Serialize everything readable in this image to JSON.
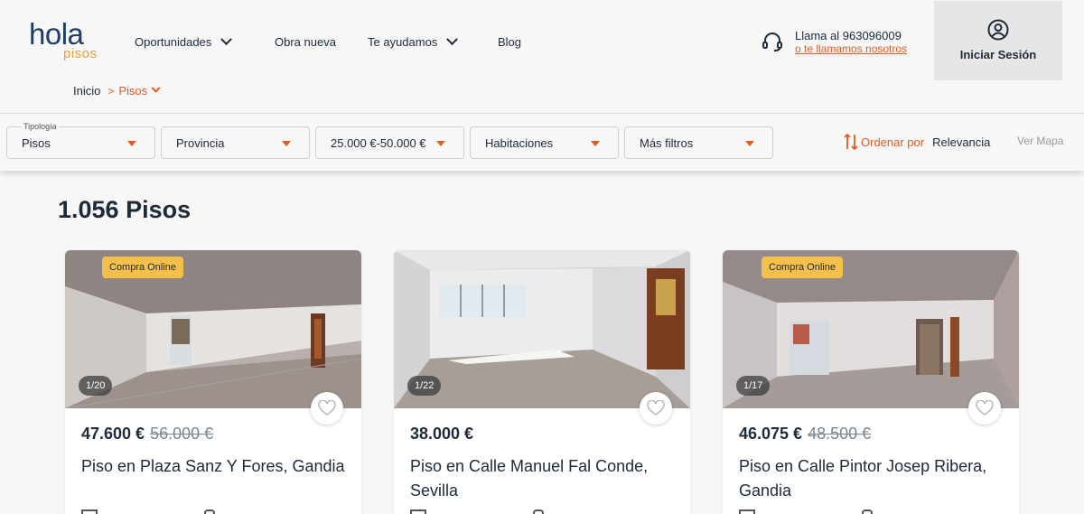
{
  "header": {
    "logo_main": "hola",
    "logo_sub": "pisos",
    "nav": [
      {
        "label": "Oportunidades",
        "dropdown": true
      },
      {
        "label": "Obra nueva",
        "dropdown": false
      },
      {
        "label": "Te ayudamos",
        "dropdown": true
      },
      {
        "label": "Blog",
        "dropdown": false
      }
    ],
    "phone_text": "Llama al 963096009",
    "callback_link": "o te llamamos nosotros",
    "login_label": "Iniciar Sesión"
  },
  "breadcrumb": {
    "home": "Inicio",
    "separator": ">",
    "current": "Pisos"
  },
  "filters": {
    "tipologia_label": "Tipología",
    "tipologia_value": "Pisos",
    "provincia": "Provincia",
    "precio": "25.000 €-50.000 €",
    "habitaciones": "Habitaciones",
    "mas_filtros": "Más filtros",
    "sort_label": "Ordenar por",
    "sort_value": "Relevancia",
    "ver_mapa": "Ver Mapa"
  },
  "results": {
    "title": "1.056 Pisos"
  },
  "listings": [
    {
      "badge": "Compra Online",
      "counter": "1/20",
      "price": "47.600 €",
      "old_price": "56.000 €",
      "title": "Piso en Plaza Sanz Y Fores, Gandia"
    },
    {
      "badge": "",
      "counter": "1/22",
      "price": "38.000 €",
      "old_price": "",
      "title": "Piso en Calle Manuel Fal Conde, Sevilla"
    },
    {
      "badge": "Compra Online",
      "counter": "1/17",
      "price": "46.075 €",
      "old_price": "48.500 €",
      "title": "Piso en Calle Pintor Josep Ribera, Gandia"
    }
  ],
  "colors": {
    "accent": "#e45a23",
    "brand_navy": "#1f3e68",
    "brand_gold": "#e8a23c",
    "badge": "#f4bf4a"
  }
}
